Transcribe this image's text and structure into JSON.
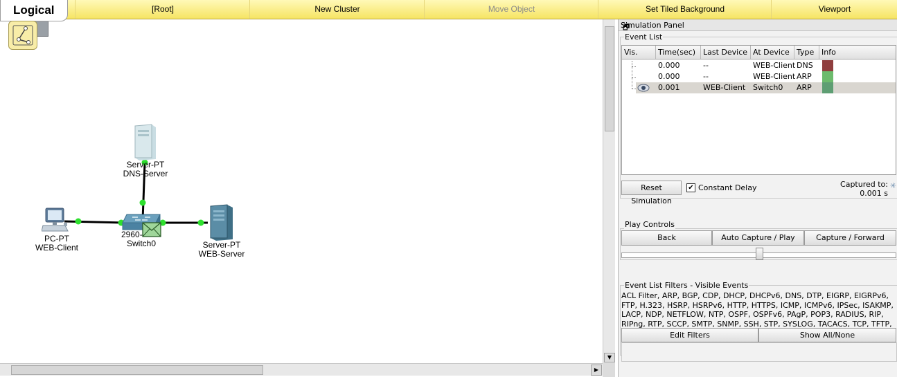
{
  "toolbar": {
    "logical_label": "Logical",
    "items": [
      {
        "label": "[Root]"
      },
      {
        "label": "New Cluster"
      },
      {
        "label": "Move Object"
      },
      {
        "label": "Set Tiled Background"
      },
      {
        "label": "Viewport"
      }
    ]
  },
  "devices": {
    "dns_server": {
      "model": "Server-PT",
      "name": "DNS-Server"
    },
    "web_client": {
      "model": "PC-PT",
      "name": "WEB-Client"
    },
    "switch": {
      "model": "2960-",
      "name": "Switch0"
    },
    "web_server": {
      "model": "Server-PT",
      "name": "WEB-Server"
    }
  },
  "simulation_panel": {
    "title": "Simulation Panel",
    "event_list_label": "Event List",
    "columns": [
      "Vis.",
      "Time(sec)",
      "Last Device",
      "At Device",
      "Type",
      "Info"
    ],
    "events": [
      {
        "time": "0.000",
        "last_device": "--",
        "at_device": "WEB-Client",
        "type": "DNS",
        "color": "#8f3e3e",
        "selected": false
      },
      {
        "time": "0.000",
        "last_device": "--",
        "at_device": "WEB-Client",
        "type": "ARP",
        "color": "#6dbb6d",
        "selected": false
      },
      {
        "time": "0.001",
        "last_device": "WEB-Client",
        "at_device": "Switch0",
        "type": "ARP",
        "color": "#5e9e73",
        "selected": true
      }
    ],
    "reset_button": "Reset Simulation",
    "constant_delay_label": "Constant Delay",
    "constant_delay_checked": true,
    "captured_label": "Captured to:",
    "captured_value": "0.001 s",
    "play_controls_label": "Play Controls",
    "back_button": "Back",
    "auto_capture_button": "Auto Capture / Play",
    "capture_forward_button": "Capture / Forward",
    "filters_label": "Event List Filters - Visible Events",
    "filters_text": "ACL Filter, ARP, BGP, CDP, DHCP, DHCPv6, DNS, DTP, EIGRP, EIGRPv6, FTP, H.323, HSRP, HSRPv6, HTTP, HTTPS, ICMP, ICMPv6, IPSec, ISAKMP, LACP, NDP, NETFLOW, NTP, OSPF, OSPFv6, PAgP, POP3, RADIUS, RIP, RIPng, RTP, SCCP, SMTP, SNMP, SSH, STP, SYSLOG, TACACS, TCP, TFTP, Telnet, UDP, VTP",
    "edit_filters_button": "Edit Filters",
    "show_all_button": "Show All/None"
  }
}
